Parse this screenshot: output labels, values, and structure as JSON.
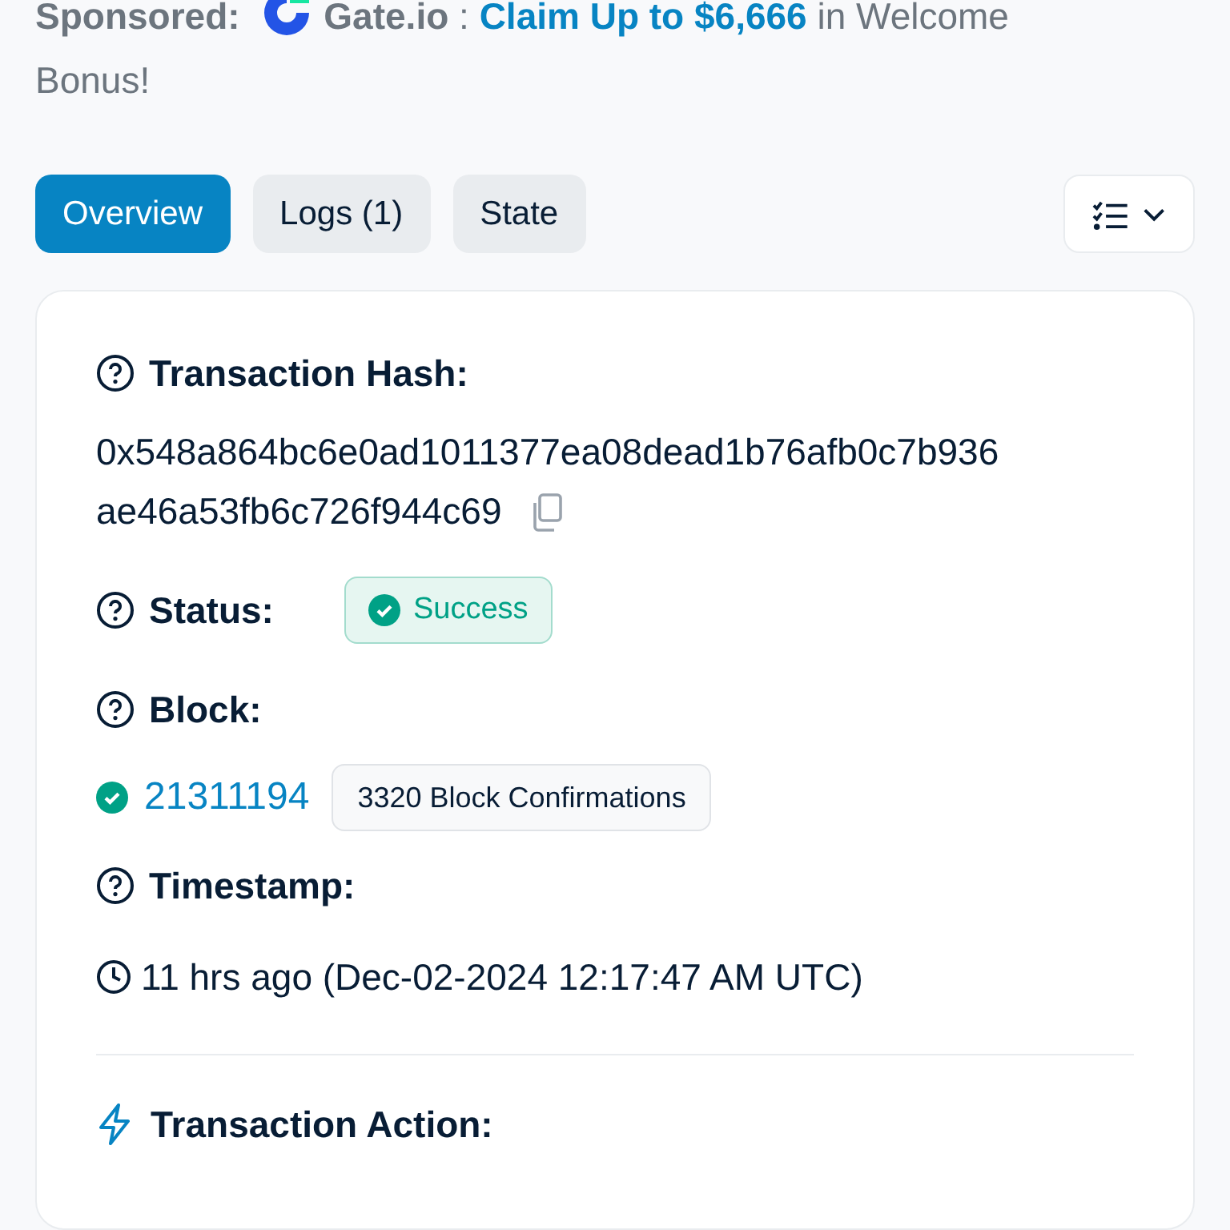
{
  "sponsor": {
    "label": "Sponsored:",
    "brand": "Gate.io",
    "separator": ":",
    "link": "Claim Up to $6,666",
    "text_lines": [
      "in Welcome",
      "Bonus!"
    ]
  },
  "tabs": [
    {
      "label": "Overview",
      "selected": true
    },
    {
      "label": "Logs (1)",
      "selected": false
    },
    {
      "label": "State",
      "selected": false
    }
  ],
  "details": [
    {
      "kind": "hash",
      "label": "Transaction Hash:",
      "value_lines": [
        "0x548a864bc6e0ad1011377ea08dead1b76afb0c7b936",
        "ae46a53fb6c726f944c69"
      ]
    },
    {
      "kind": "status",
      "label": "Status:",
      "value": "Success"
    },
    {
      "kind": "block",
      "label": "Block:",
      "value": "21311194",
      "badge": "3320 Block Confirmations"
    },
    {
      "kind": "time",
      "label": "Timestamp:",
      "value": "11 hrs ago (Dec-02-2024 12:17:47 AM UTC)"
    },
    {
      "kind": "action",
      "label": "Transaction Action:"
    }
  ]
}
